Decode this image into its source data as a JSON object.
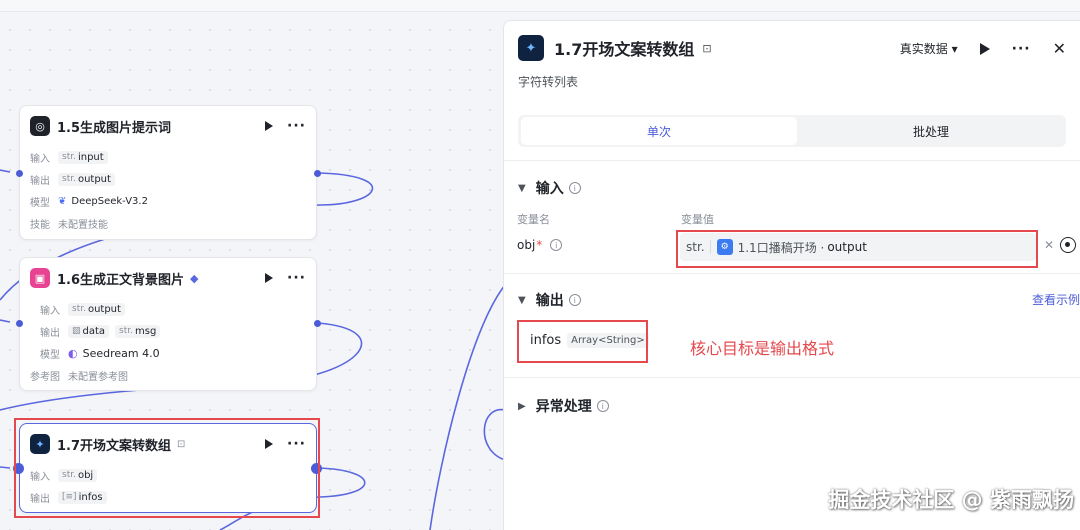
{
  "nodes": [
    {
      "title": "1.5生成图片提示词",
      "rows": [
        {
          "label": "输入",
          "tags": [
            {
              "pre": "str.",
              "text": "input"
            }
          ]
        },
        {
          "label": "输出",
          "tags": [
            {
              "pre": "str.",
              "text": "output"
            }
          ]
        },
        {
          "label": "模型",
          "text": "DeepSeek-V3.2"
        },
        {
          "label": "技能",
          "text": "未配置技能"
        }
      ]
    },
    {
      "title": "1.6生成正文背景图片",
      "rows": [
        {
          "label": "输入",
          "tags": [
            {
              "pre": "str.",
              "text": "output"
            }
          ]
        },
        {
          "label": "输出",
          "tags": [
            {
              "pre": "",
              "text": "data"
            },
            {
              "pre": "str.",
              "text": "msg"
            }
          ]
        },
        {
          "label": "模型",
          "text": "Seedream 4.0"
        },
        {
          "label": "参考图",
          "text": "未配置参考图"
        }
      ]
    },
    {
      "title": "1.7开场文案转数组",
      "rows": [
        {
          "label": "输入",
          "tags": [
            {
              "pre": "str.",
              "text": "obj"
            }
          ]
        },
        {
          "label": "输出",
          "tags": [
            {
              "pre": "",
              "text": "infos"
            }
          ]
        }
      ]
    }
  ],
  "panel": {
    "title": "1.7开场文案转数组",
    "subtitle": "字符转列表",
    "data_mode": "真实数据 ▾",
    "tabs": [
      "单次",
      "批处理"
    ],
    "input_section": "输入",
    "col_name": "变量名",
    "col_value": "变量值",
    "input_var": {
      "name": "obj",
      "type": "str.",
      "ref_node": "1.1口播稿开场 ·",
      "ref_var": "output"
    },
    "output_section": "输出",
    "view_example": "查看示例",
    "output_var": {
      "name": "infos",
      "type": "Array<String>"
    },
    "annotation": "核心目标是输出格式",
    "error_section": "异常处理"
  },
  "watermark": "掘金技术社区 @ 紫雨飘扬",
  "colors": {
    "accent": "#4c5cd8",
    "highlight": "#e5484d"
  }
}
